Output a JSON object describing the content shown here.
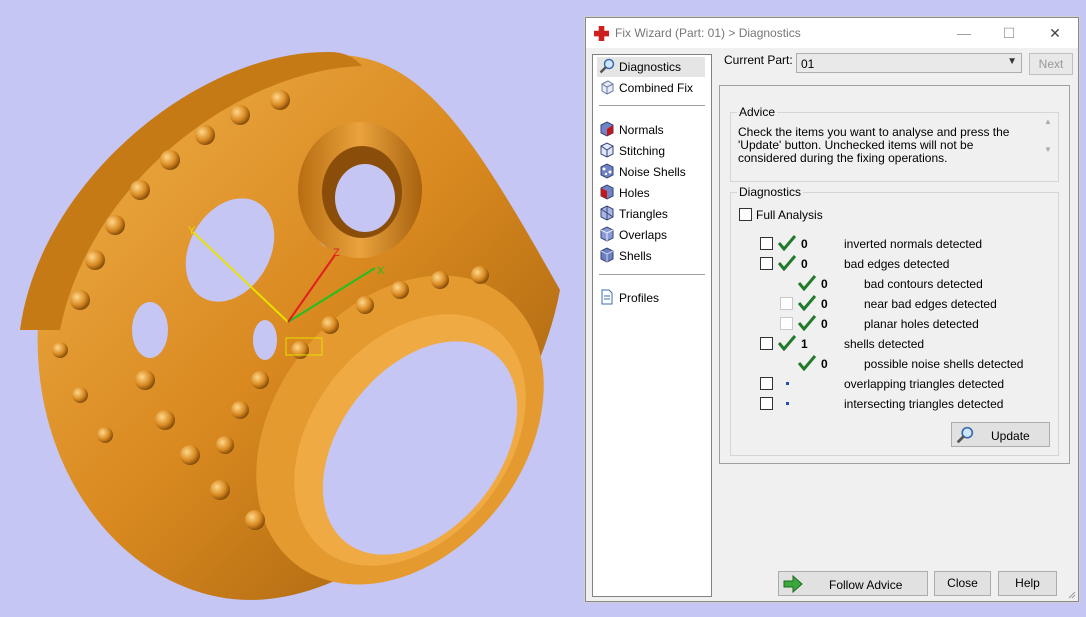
{
  "colors": {
    "viewport_bg": "#c6c6f4",
    "gold": "#d98a22",
    "check_green": "#1f7a2a",
    "title_icon_red": "#cc2020"
  },
  "window": {
    "title": "Fix Wizard (Part: 01) > Diagnostics",
    "minimize": "—",
    "maximize": "☐",
    "close": "✕"
  },
  "sidebar": {
    "items": [
      {
        "label": "Diagnostics",
        "icon": "magnifier-icon"
      },
      {
        "label": "Combined Fix",
        "icon": "combined-fix-icon"
      },
      {
        "label": "Normals",
        "icon": "normals-cube-icon"
      },
      {
        "label": "Stitching",
        "icon": "stitching-cube-icon"
      },
      {
        "label": "Noise Shells",
        "icon": "noise-shells-icon"
      },
      {
        "label": "Holes",
        "icon": "holes-cube-icon"
      },
      {
        "label": "Triangles",
        "icon": "triangles-cube-icon"
      },
      {
        "label": "Overlaps",
        "icon": "overlaps-cube-icon"
      },
      {
        "label": "Shells",
        "icon": "shells-cube-icon"
      },
      {
        "label": "Profiles",
        "icon": "profiles-document-icon"
      }
    ]
  },
  "current_part": {
    "label": "Current Part:",
    "value": "01",
    "next_label": "Next"
  },
  "advice": {
    "title": "Advice",
    "text": "Check the items you want to analyse and press the 'Update' button. Unchecked items will not be considered during the fixing operations."
  },
  "diagnostics": {
    "title": "Diagnostics",
    "full_analysis": "Full Analysis",
    "rows": [
      {
        "count": "0",
        "label": "inverted normals detected"
      },
      {
        "count": "0",
        "label": "bad edges detected"
      },
      {
        "count": "0",
        "label": "bad contours detected"
      },
      {
        "count": "0",
        "label": "near bad edges detected"
      },
      {
        "count": "0",
        "label": "planar holes detected"
      },
      {
        "count": "1",
        "label": "shells detected"
      },
      {
        "count": "0",
        "label": "possible noise shells detected"
      },
      {
        "count": "",
        "label": "overlapping triangles detected"
      },
      {
        "count": "",
        "label": "intersecting triangles detected"
      }
    ],
    "update_label": "Update"
  },
  "footer": {
    "follow_advice": "Follow Advice",
    "close": "Close",
    "help": "Help"
  },
  "scene": {
    "axis_label_x": "X",
    "axis_label_y": "Y",
    "axis_label_z": "Z"
  }
}
